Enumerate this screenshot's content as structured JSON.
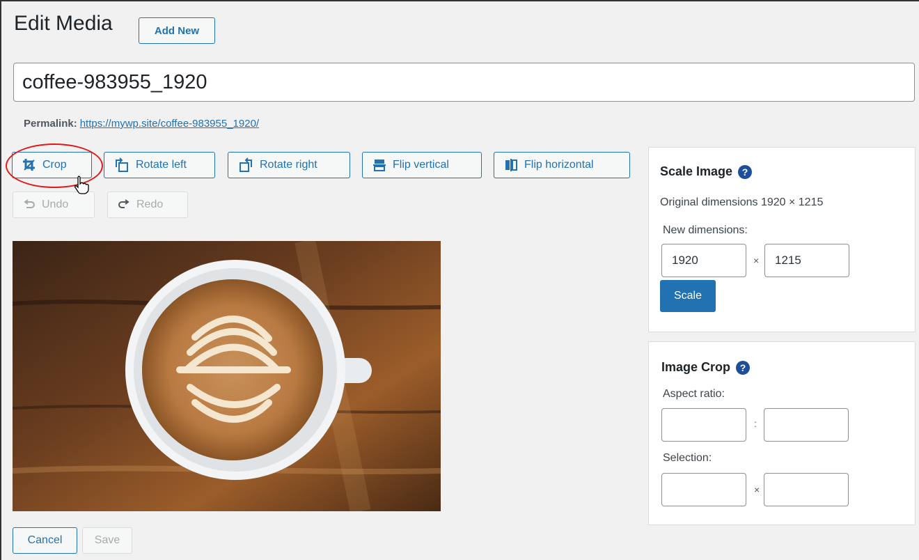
{
  "header": {
    "title": "Edit Media",
    "add_new_label": "Add New"
  },
  "title_field": {
    "value": "coffee-983955_1920"
  },
  "permalink": {
    "label": "Permalink:",
    "url": "https://mywp.site/coffee-983955_1920/"
  },
  "toolbar": {
    "crop_label": "Crop",
    "rotate_left_label": "Rotate left",
    "rotate_right_label": "Rotate right",
    "flip_vertical_label": "Flip vertical",
    "flip_horizontal_label": "Flip horizontal",
    "undo_label": "Undo",
    "redo_label": "Redo"
  },
  "footer": {
    "cancel_label": "Cancel",
    "save_label": "Save"
  },
  "scale_panel": {
    "title": "Scale Image",
    "help_glyph": "?",
    "original_dimensions": "Original dimensions 1920 × 1215",
    "new_dimensions_label": "New dimensions:",
    "width_value": "1920",
    "height_value": "1215",
    "times_sign": "×",
    "scale_button": "Scale"
  },
  "crop_panel": {
    "title": "Image Crop",
    "help_glyph": "?",
    "aspect_ratio_label": "Aspect ratio:",
    "ratio_separator": ":",
    "selection_label": "Selection:",
    "times_sign": "×",
    "aspect_w": "",
    "aspect_h": "",
    "selection_w": "",
    "selection_h": ""
  },
  "colors": {
    "accent": "#2271b1",
    "highlight_circle": "#e0191b",
    "background": "#f1f1f1"
  },
  "icons": [
    "crop-icon",
    "rotate-left-icon",
    "rotate-right-icon",
    "flip-vertical-icon",
    "flip-horizontal-icon",
    "undo-icon",
    "redo-icon",
    "help-icon",
    "hand-cursor-icon"
  ]
}
